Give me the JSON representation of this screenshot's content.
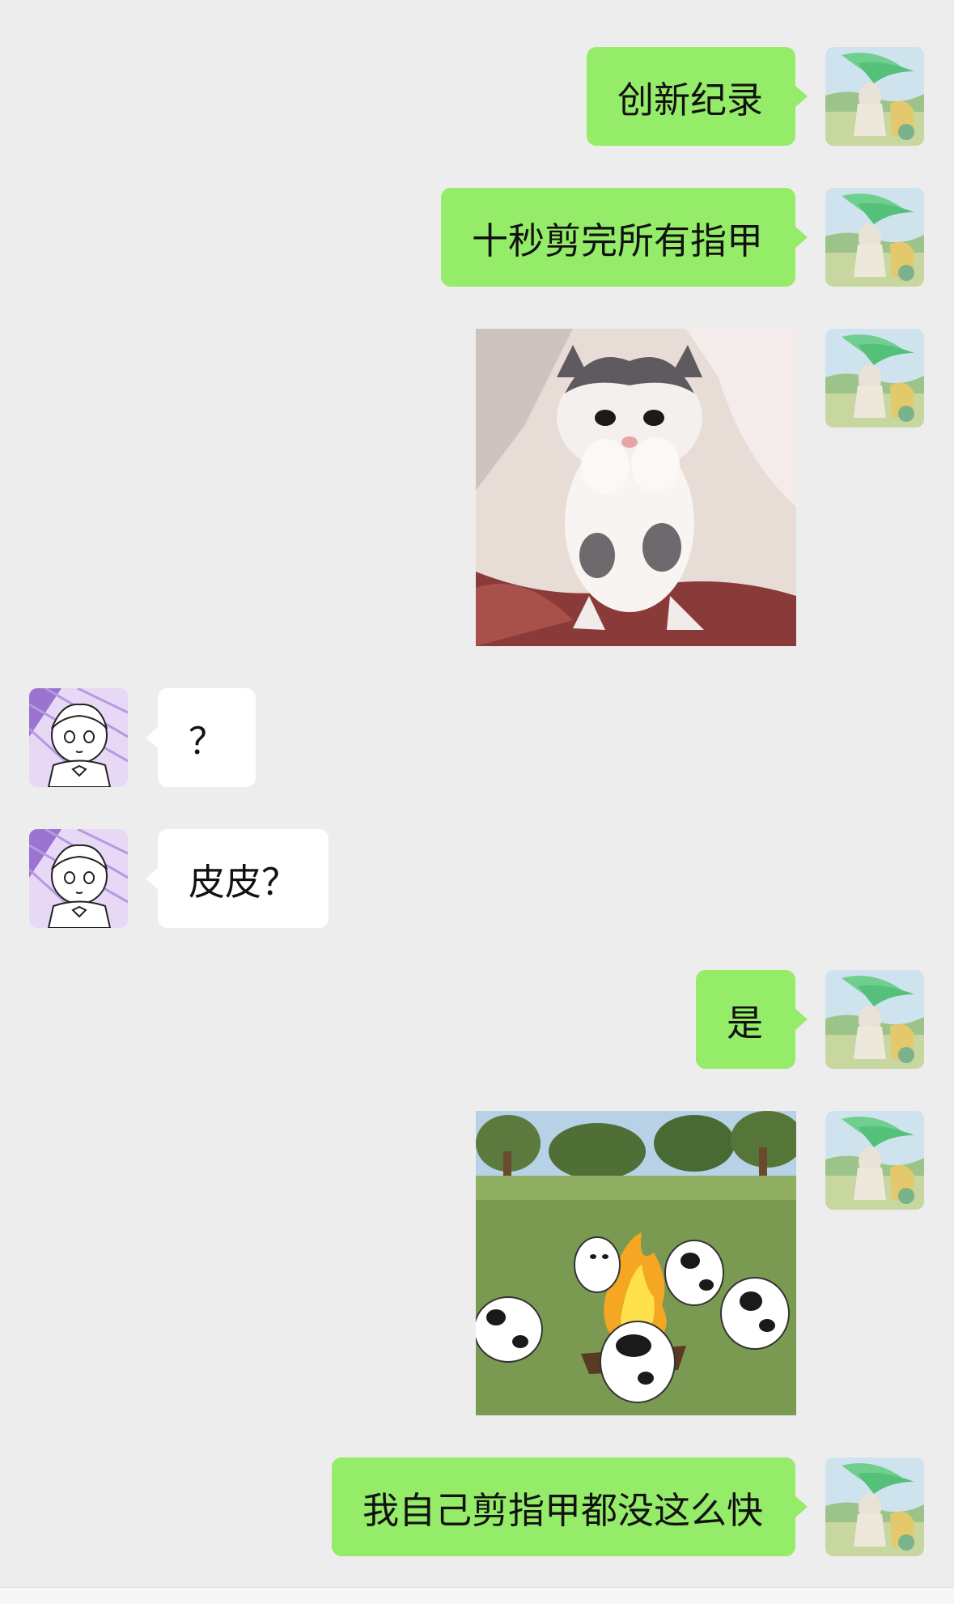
{
  "chat": {
    "messages": [
      {
        "sender": "me",
        "type": "text",
        "text": "创新纪录"
      },
      {
        "sender": "me",
        "type": "text",
        "text": "十秒剪完所有指甲"
      },
      {
        "sender": "me",
        "type": "sticker",
        "sticker": "dancing-kitten"
      },
      {
        "sender": "other",
        "type": "text",
        "text": "？"
      },
      {
        "sender": "other",
        "type": "text",
        "text": "皮皮？"
      },
      {
        "sender": "me",
        "type": "text",
        "text": "是"
      },
      {
        "sender": "me",
        "type": "sticker",
        "sticker": "cows-dancing-around-campfire"
      },
      {
        "sender": "me",
        "type": "text",
        "text": "我自己剪指甲都没这么快"
      }
    ]
  },
  "avatars": {
    "me": "green-haired-anime-avatar",
    "other": "purple-anime-girl-avatar"
  },
  "colors": {
    "background": "#ededed",
    "my_bubble": "#95ec69",
    "their_bubble": "#ffffff",
    "text": "#111111"
  }
}
